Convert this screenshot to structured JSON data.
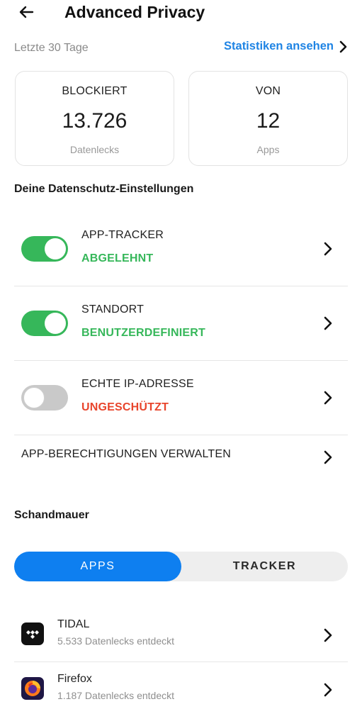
{
  "header": {
    "title": "Advanced Privacy",
    "back_icon": "arrow-left-icon"
  },
  "period": {
    "label": "Letzte 30 Tage",
    "stats_link": "Statistiken ansehen"
  },
  "cards": {
    "blocked": {
      "label": "BLOCKIERT",
      "value": "13.726",
      "unit": "Datenlecks"
    },
    "from": {
      "label": "VON",
      "value": "12",
      "unit": "Apps"
    }
  },
  "settings": {
    "title": "Deine Datenschutz-Einstellungen",
    "items": [
      {
        "name": "APP-TRACKER",
        "status": "ABGELEHNT",
        "status_color": "#36b75a",
        "enabled": true
      },
      {
        "name": "STANDORT",
        "status": "BENUTZERDEFINIERT",
        "status_color": "#36b75a",
        "enabled": true
      },
      {
        "name": "ECHTE IP-ADRESSE",
        "status": "UNGESCHÜTZT",
        "status_color": "#e8452c",
        "enabled": false
      }
    ],
    "permissions_label": "APP-BERECHTIGUNGEN VERWALTEN"
  },
  "wall": {
    "title": "Schandmauer",
    "tabs": {
      "apps": "APPS",
      "tracker": "TRACKER",
      "selected": "apps"
    },
    "apps": [
      {
        "name": "TIDAL",
        "detail": "5.533 Datenlecks entdeckt",
        "icon": "tidal-icon"
      },
      {
        "name": "Firefox",
        "detail": "1.187 Datenlecks entdeckt",
        "icon": "firefox-icon"
      }
    ]
  },
  "colors": {
    "accent": "#1f84e4",
    "tab_selected": "#0e7ff0",
    "toggle_on": "#36b75a",
    "warning": "#e8452c"
  }
}
